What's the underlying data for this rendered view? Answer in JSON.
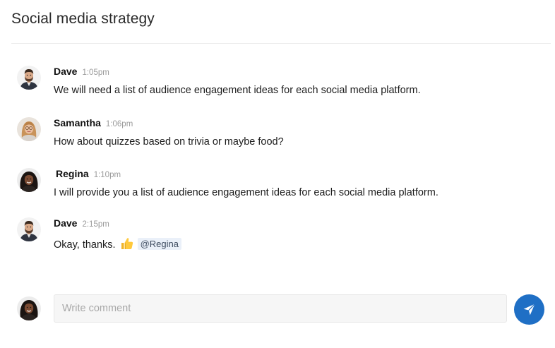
{
  "page": {
    "title": "Social media strategy"
  },
  "messages": [
    {
      "author": "Dave",
      "time": "1:05pm",
      "text": "We will need a list of audience engagement ideas for each social media platform.",
      "avatar": "dave"
    },
    {
      "author": "Samantha",
      "time": "1:06pm",
      "text": "How about quizzes based on trivia or maybe food?",
      "avatar": "samantha"
    },
    {
      "author": "Regina",
      "time": "1:10pm",
      "text": "I will provide you a list of audience engagement ideas for each social media platform.",
      "avatar": "regina"
    },
    {
      "author": "Dave",
      "time": "2:15pm",
      "text": "Okay, thanks.",
      "emoji": "thumbs-up-icon",
      "mention": "@Regina",
      "avatar": "dave"
    }
  ],
  "composer": {
    "placeholder": "Write comment",
    "value": "",
    "avatar": "regina",
    "send_icon": "paper-plane-icon"
  },
  "colors": {
    "accent": "#1f6fc5",
    "mention_bg": "#eaf0f9",
    "timestamp": "#9a9a9a",
    "divider": "#ececec"
  }
}
